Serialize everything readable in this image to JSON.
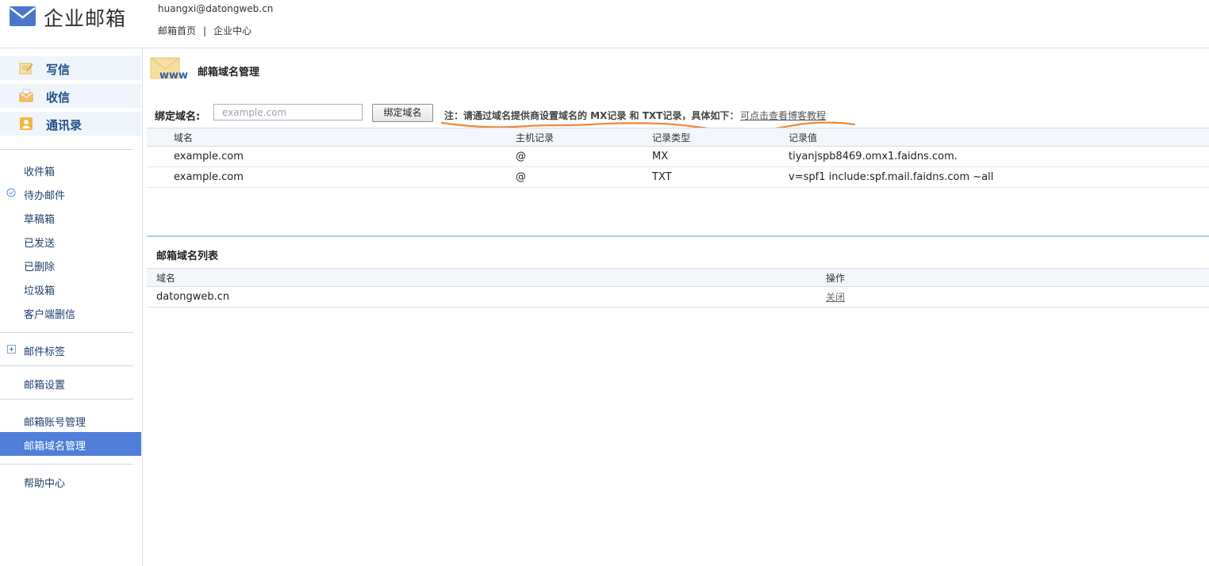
{
  "header": {
    "logo_text": "企业邮箱",
    "user_email": "huangxi@datongweb.cn",
    "nav": [
      "邮箱首页",
      "企业中心"
    ],
    "nav_separator": "|"
  },
  "sidebar": {
    "quick_actions": [
      {
        "label": "写信",
        "icon": "compose-icon"
      },
      {
        "label": "收信",
        "icon": "receive-mail-icon"
      },
      {
        "label": "通讯录",
        "icon": "contacts-icon"
      }
    ],
    "folders": [
      "收件箱",
      "待办邮件",
      "草稿箱",
      "已发送",
      "已删除",
      "垃圾箱",
      "客户端删信"
    ],
    "tags_label": "邮件标签",
    "settings_label": "邮箱设置",
    "admin_items": [
      "邮箱账号管理",
      "邮箱域名管理"
    ],
    "active_item": "邮箱域名管理",
    "help_label": "帮助中心"
  },
  "main": {
    "title": "邮箱域名管理",
    "title_icon": "www-mail-icon",
    "bind_label": "绑定域名:",
    "input_placeholder": "example.com",
    "input_value": "",
    "bind_button": "绑定域名",
    "note": "注：请通过域名提供商设置域名的 MX记录 和 TXT记录，具体如下：",
    "note_link": "可点击查看博客教程",
    "records_table": {
      "headers": [
        "域名",
        "主机记录",
        "记录类型",
        "记录值"
      ],
      "rows": [
        [
          "example.com",
          "@",
          "MX",
          "tiyanjspb8469.omx1.faidns.com."
        ],
        [
          "example.com",
          "@",
          "TXT",
          "v=spf1 include:spf.mail.faidns.com ~all"
        ]
      ]
    },
    "list_title": "邮箱域名列表",
    "list_table": {
      "headers": [
        "域名",
        "操作"
      ],
      "rows": [
        {
          "domain": "datongweb.cn",
          "action": "关闭"
        }
      ]
    }
  },
  "colors": {
    "active_nav_bg": "#4f7fd8",
    "annotation_orange": "#f0883a",
    "sidebar_label": "#1f3f6a"
  }
}
